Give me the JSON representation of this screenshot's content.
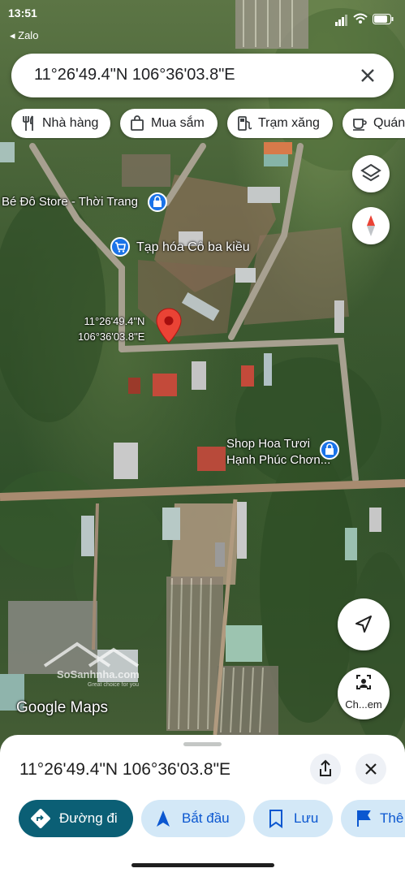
{
  "status_bar": {
    "time": "13:51",
    "back_app": "◂ Zalo"
  },
  "search": {
    "query": "11°26'49.4\"N 106°36'03.8\"E"
  },
  "chips": [
    {
      "label": "Nhà hàng",
      "icon": "restaurant-icon"
    },
    {
      "label": "Mua sắm",
      "icon": "shopping-icon"
    },
    {
      "label": "Trạm xăng",
      "icon": "gas-station-icon"
    },
    {
      "label": "Quán",
      "icon": "cafe-icon"
    }
  ],
  "map": {
    "pin_label_line1": "11°26'49.4\"N",
    "pin_label_line2": "106°36'03.8\"E",
    "places": [
      {
        "name": "Bé Đô Store - Thời Trang",
        "icon": "shopping-bag-icon",
        "color": "#1a73e8"
      },
      {
        "name": "Tạp hóa Cô ba kiều",
        "icon": "shopping-cart-icon",
        "color": "#1a73e8"
      },
      {
        "name": "Shop Hoa Tươi",
        "name_line2": "Hạnh Phúc Chơn...",
        "icon": "shopping-bag-icon",
        "color": "#1a73e8"
      }
    ],
    "street_view_label": "Ch...em",
    "watermark": "SoSanhnha.com",
    "watermark_tagline": "Great choice for you",
    "attribution": "Google Maps",
    "pin_color": "#ea4335"
  },
  "sheet": {
    "title": "11°26'49.4\"N 106°36'03.8\"E",
    "actions": [
      {
        "label": "Đường đi",
        "icon": "directions-icon"
      },
      {
        "label": "Bắt đầu",
        "icon": "navigation-icon"
      },
      {
        "label": "Lưu",
        "icon": "bookmark-icon"
      },
      {
        "label": "Thê",
        "icon": "flag-icon"
      }
    ]
  }
}
